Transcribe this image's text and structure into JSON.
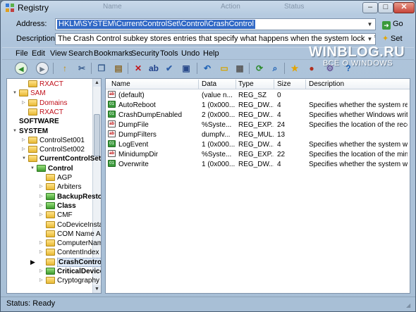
{
  "window": {
    "title": "Registry",
    "ghost_headers": [
      "Name",
      "Action",
      "Status"
    ],
    "controls": {
      "minimize": "–",
      "maximize": "□",
      "close": "✕"
    }
  },
  "address": {
    "label": "Address:",
    "value": "HKLM\\SYSTEM\\CurrentControlSet\\Control\\CrashControl",
    "go_label": "Go"
  },
  "description": {
    "label": "Description:",
    "value": "The Crash Control subkey stores entries that specify what happens when the system locks, fails, or terminates",
    "set_label": "Set"
  },
  "menu": [
    "File",
    "Edit",
    "View",
    "Search",
    "Bookmarks",
    "Security",
    "Tools",
    "Undo",
    "Help"
  ],
  "watermark": {
    "main": "WINBLOG.RU",
    "sub": "ВСЁ О WINDOWS"
  },
  "toolbar": [
    {
      "icon": "back-icon",
      "glyph": "◀",
      "color": "#2d8a2d"
    },
    {
      "icon": "forward-icon",
      "glyph": "▶",
      "color": "#6d7b8a"
    },
    {
      "icon": "up-folder-icon",
      "glyph": "↑",
      "color": "#c78b00"
    },
    {
      "icon": "cut-icon",
      "glyph": "✂",
      "color": "#3b5f8f"
    },
    {
      "icon": "copy-icon",
      "glyph": "❐",
      "color": "#3b5f8f"
    },
    {
      "icon": "paste-icon",
      "glyph": "▤",
      "color": "#8a6a2d"
    },
    {
      "icon": "delete-icon",
      "glyph": "✕",
      "color": "#c2161a"
    },
    {
      "icon": "rename-icon",
      "glyph": "ab",
      "color": "#1e3f8a"
    },
    {
      "icon": "properties-icon",
      "glyph": "✔",
      "color": "#2d5ea8"
    },
    {
      "icon": "save-icon",
      "glyph": "▣",
      "color": "#2a4a8a"
    },
    {
      "icon": "undo-icon",
      "glyph": "↶",
      "color": "#1a5fb4"
    },
    {
      "icon": "folder-icon",
      "glyph": "▭",
      "color": "#d5a400"
    },
    {
      "icon": "export-icon",
      "glyph": "▦",
      "color": "#5a5a5a"
    },
    {
      "icon": "refresh-icon",
      "glyph": "⟳",
      "color": "#2d8a2d"
    },
    {
      "icon": "find-icon",
      "glyph": "⌕",
      "color": "#1a5fb4"
    },
    {
      "icon": "favorites-icon",
      "glyph": "★",
      "color": "#e3a400"
    },
    {
      "icon": "tools-icon",
      "glyph": "●",
      "color": "#b03020"
    },
    {
      "icon": "settings-icon",
      "glyph": "⚙",
      "color": "#6a5a9a"
    },
    {
      "icon": "help-icon",
      "glyph": "?",
      "color": "#1a5fb4"
    }
  ],
  "tree": [
    {
      "label": "RXACT",
      "indent": 1,
      "exp": "",
      "style": "red",
      "folder": "yellow"
    },
    {
      "label": "SAM",
      "indent": 0,
      "exp": "▼",
      "style": "red",
      "folder": "yellow"
    },
    {
      "label": "Domains",
      "indent": 1,
      "exp": "▷",
      "style": "red",
      "folder": "yellow"
    },
    {
      "label": "RXACT",
      "indent": 1,
      "exp": "",
      "style": "red",
      "folder": "yellow"
    },
    {
      "label": "SOFTWARE",
      "indent": 0,
      "exp": "",
      "style": "bold",
      "folder": "none"
    },
    {
      "label": "SYSTEM",
      "indent": 0,
      "exp": "▼",
      "style": "bold",
      "folder": "none"
    },
    {
      "label": "ControlSet001",
      "indent": 1,
      "exp": "▷",
      "style": "",
      "folder": "yellow"
    },
    {
      "label": "ControlSet002",
      "indent": 1,
      "exp": "▷",
      "style": "",
      "folder": "yellow"
    },
    {
      "label": "CurrentControlSet",
      "indent": 1,
      "exp": "▼",
      "style": "bold",
      "folder": "yellow"
    },
    {
      "label": "Control",
      "indent": 2,
      "exp": "▼",
      "style": "bold",
      "folder": "green"
    },
    {
      "label": "AGP",
      "indent": 3,
      "exp": "",
      "style": "",
      "folder": "yellow"
    },
    {
      "label": "Arbiters",
      "indent": 3,
      "exp": "▷",
      "style": "",
      "folder": "yellow"
    },
    {
      "label": "BackupRestor",
      "indent": 3,
      "exp": "▷",
      "style": "bold",
      "folder": "green"
    },
    {
      "label": "Class",
      "indent": 3,
      "exp": "▷",
      "style": "bold",
      "folder": "green"
    },
    {
      "label": "CMF",
      "indent": 3,
      "exp": "▷",
      "style": "",
      "folder": "yellow"
    },
    {
      "label": "CoDeviceInstal",
      "indent": 3,
      "exp": "",
      "style": "",
      "folder": "yellow"
    },
    {
      "label": "COM Name Ar",
      "indent": 3,
      "exp": "",
      "style": "",
      "folder": "yellow"
    },
    {
      "label": "ComputerNam",
      "indent": 3,
      "exp": "▷",
      "style": "",
      "folder": "yellow"
    },
    {
      "label": "ContentIndex",
      "indent": 3,
      "exp": "▷",
      "style": "",
      "folder": "yellow"
    },
    {
      "label": "CrashControl",
      "indent": 3,
      "exp": "",
      "style": "bold sel",
      "folder": "yellow"
    },
    {
      "label": "CriticalDevice",
      "indent": 3,
      "exp": "▷",
      "style": "bold",
      "folder": "green"
    },
    {
      "label": "Cryptography",
      "indent": 3,
      "exp": "▷",
      "style": "",
      "folder": "yellow"
    }
  ],
  "list": {
    "columns": [
      "Name",
      "Data",
      "Type",
      "Size",
      "Description"
    ],
    "rows": [
      {
        "icon": "str",
        "name": "(default)",
        "data": "(value n...",
        "type": "REG_SZ",
        "size": "0",
        "desc": ""
      },
      {
        "icon": "num",
        "name": "AutoReboot",
        "data": "1  (0x000...",
        "type": "REG_DW...",
        "size": "4",
        "desc": "Specifies whether the system rest..."
      },
      {
        "icon": "num",
        "name": "CrashDumpEnabled",
        "data": "2  (0x000...",
        "type": "REG_DW...",
        "size": "4",
        "desc": "Specifies whether Windows write..."
      },
      {
        "icon": "str",
        "name": "DumpFile",
        "data": "%Syste...",
        "type": "REG_EXP...",
        "size": "24",
        "desc": "Specifies the location of the reco..."
      },
      {
        "icon": "str",
        "name": "DumpFilters",
        "data": "dumpfv...",
        "type": "REG_MUL...",
        "size": "13",
        "desc": ""
      },
      {
        "icon": "num",
        "name": "LogEvent",
        "data": "1  (0x000...",
        "type": "REG_DW...",
        "size": "4",
        "desc": "Specifies whether the system writ..."
      },
      {
        "icon": "str",
        "name": "MinidumpDir",
        "data": "%Syste...",
        "type": "REG_EXP...",
        "size": "22",
        "desc": "Specifies the location of the mini..."
      },
      {
        "icon": "num",
        "name": "Overwrite",
        "data": "1  (0x000...",
        "type": "REG_DW...",
        "size": "4",
        "desc": "Specifies whether the system writ..."
      }
    ]
  },
  "status": "Status: Ready"
}
